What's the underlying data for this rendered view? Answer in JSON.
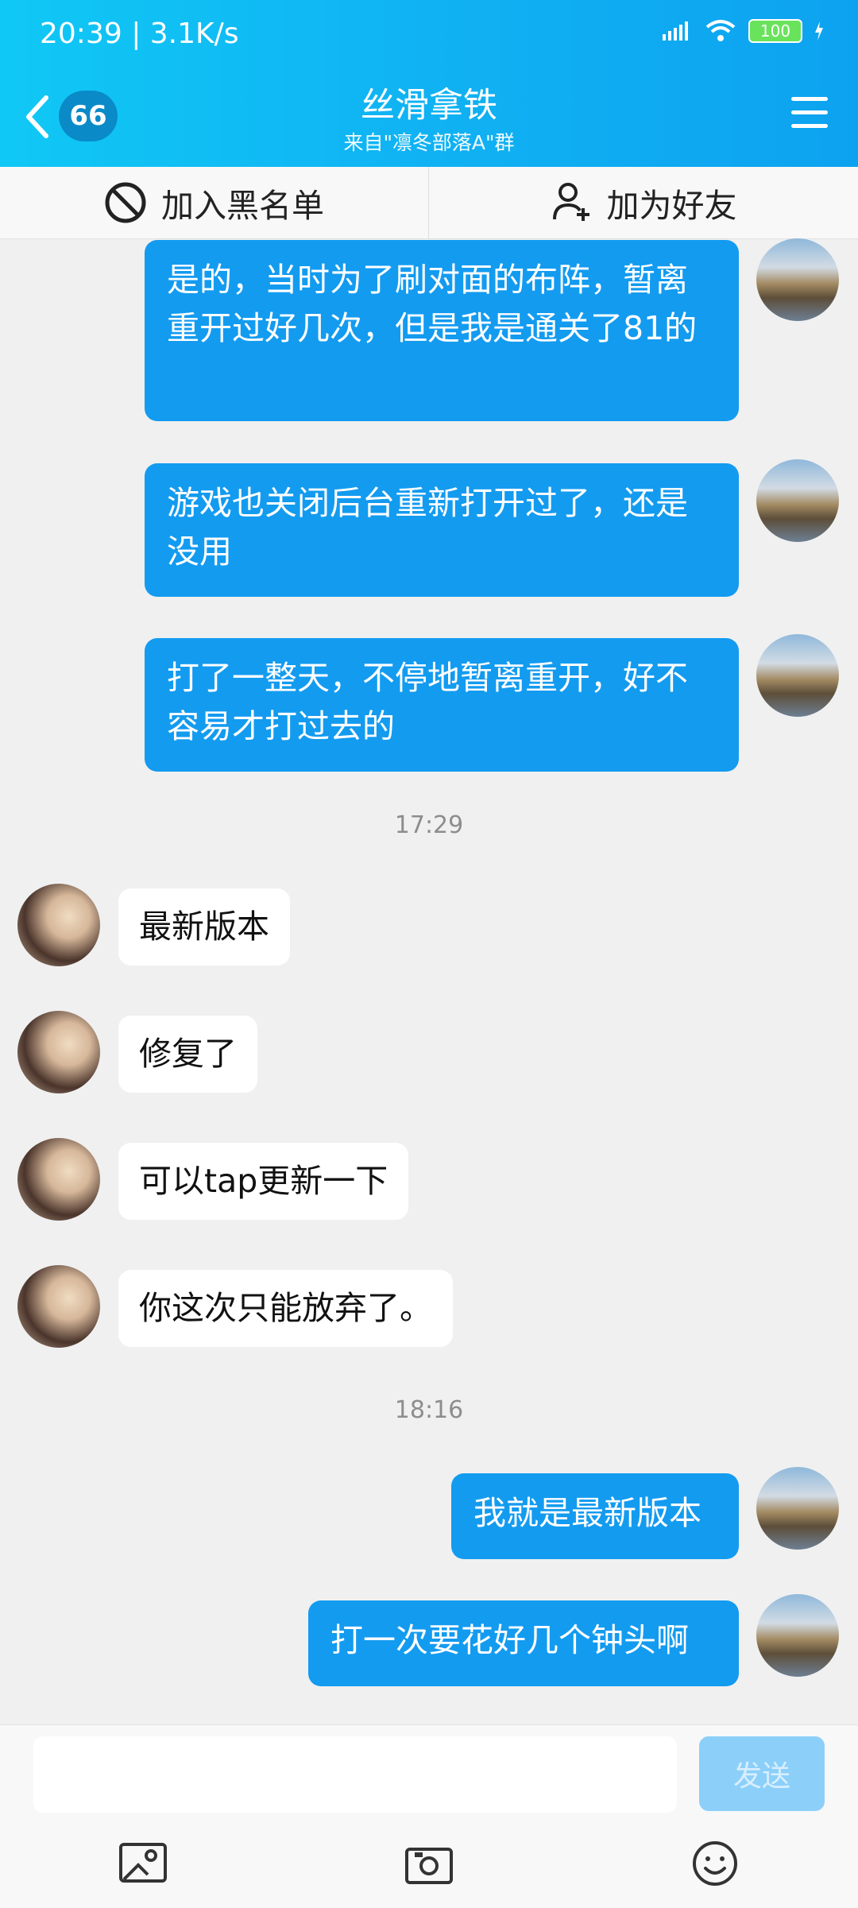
{
  "status_bar": {
    "time_speed": "20:39 | 3.1K/s",
    "battery": "100"
  },
  "header": {
    "back_badge": "66",
    "title": "丝滑拿铁",
    "subtitle": "来自\"凛冬部落A\"群"
  },
  "actions": {
    "blacklist": "加入黑名单",
    "add_friend": "加为好友"
  },
  "messages": {
    "m1": "是的，当时为了刷对面的布阵，暂离重开过好几次，但是我是通关了81的",
    "m2": "游戏也关闭后台重新打开过了，还是没用",
    "m3": "打了一整天，不停地暂离重开，好不容易才打过去的",
    "time1": "17:29",
    "m4": "最新版本",
    "m5": "修复了",
    "m6": "可以tap更新一下",
    "m7": "你这次只能放弃了。",
    "time2": "18:16",
    "m8": "我就是最新版本",
    "m9": "打一次要花好几个钟头啊"
  },
  "composer": {
    "placeholder": "",
    "send_label": "发送"
  },
  "icons": {
    "back": "chevron-left-icon",
    "menu": "menu-icon",
    "blacklist": "block-icon",
    "add_friend": "add-user-icon",
    "image": "image-icon",
    "camera": "camera-icon",
    "emoji": "emoji-icon"
  },
  "colors": {
    "header_blue": "#12b4f4",
    "bubble_blue": "#139bf0",
    "send_disabled": "#8cd0fa"
  }
}
